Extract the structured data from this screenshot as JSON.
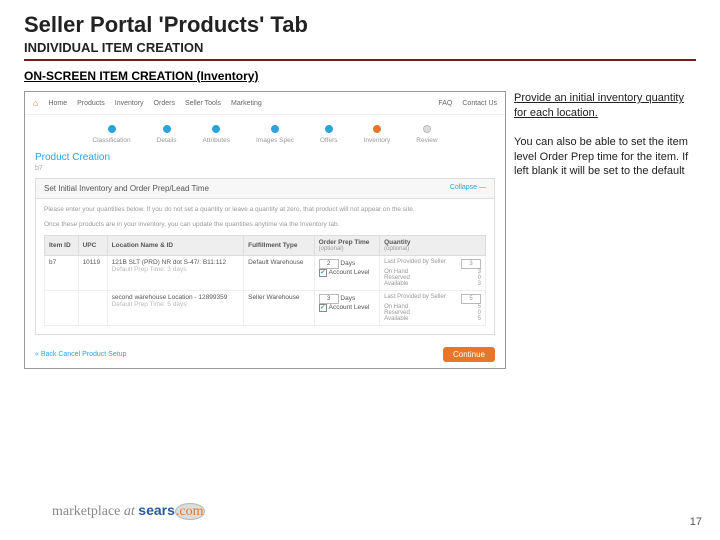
{
  "title": "Seller Portal 'Products' Tab",
  "subtitle": "INDIVIDUAL ITEM CREATION",
  "section_head": "ON-SCREEN ITEM CREATION (Inventory)",
  "notes": {
    "p1": "Provide an initial inventory quantity for each location.",
    "p2": "You can also be able to set the item level Order Prep time for the item. If left blank it will be set to the default"
  },
  "topnav": {
    "home": "Home",
    "items": [
      "Products",
      "Inventory",
      "Orders",
      "Seller Tools",
      "Marketing"
    ],
    "right": [
      "FAQ",
      "Contact Us"
    ]
  },
  "steps": [
    {
      "label": "Classification",
      "state": "prev"
    },
    {
      "label": "Details",
      "state": "prev"
    },
    {
      "label": "Attributes",
      "state": "prev"
    },
    {
      "label": "Images Spec",
      "state": "prev"
    },
    {
      "label": "Offers",
      "state": "prev"
    },
    {
      "label": "Inventory",
      "state": "active"
    },
    {
      "label": "Review",
      "state": ""
    }
  ],
  "page_header": "Product Creation",
  "page_sku": "b7",
  "panel_title": "Set Initial Inventory and Order Prep/Lead Time",
  "collapse_label": "Collapse —",
  "hint1": "Please enter your quantities below. If you do not set a quantity or leave a quantity at zero, that product will not appear on the site.",
  "hint2": "Once these products are in your inventory, you can update the quantities anytime via the Inventory tab.",
  "cols": {
    "item": "Item ID",
    "upc": "UPC",
    "loc": "Location Name & ID",
    "ftype": "Fulfillment Type",
    "prep": "Order Prep Time",
    "prep_sub": "(optional)",
    "qty": "Quantity",
    "qty_sub": "(optional)"
  },
  "rows": [
    {
      "item": "b7",
      "upc": "10119",
      "loc_name": "121B SLT (PRD) NR dot S-47/: B11:112",
      "loc_sub": "Default Prep Time: 3 days",
      "loc_id": "Default Warehouse",
      "prep": "2",
      "prep_unit": "Days",
      "acct": "Account Level",
      "qty": "3",
      "stats": {
        "last": "Last Provided by Seller",
        "onhand": "On Hand",
        "reserved": "Reserved",
        "available": "Available"
      },
      "vals": {
        "last": "3",
        "onhand": "3",
        "reserved": "0",
        "available": "3"
      }
    },
    {
      "item": "",
      "upc": "",
      "loc_name": "second warehouse Location - 12899359",
      "loc_sub": "Default Prep Time: 5 days",
      "loc_id": "Seller Warehouse",
      "prep": "3",
      "prep_unit": "Days",
      "acct": "Account Level",
      "qty": "5",
      "stats": {
        "last": "Last Provided by Seller",
        "onhand": "On Hand",
        "reserved": "Reserved",
        "available": "Available"
      },
      "vals": {
        "last": "5",
        "onhand": "5",
        "reserved": "0",
        "available": "5"
      }
    }
  ],
  "back_label": "« Back    Cancel Product Setup",
  "continue_label": "Continue",
  "footer": {
    "a": "marketplace",
    "b": "at",
    "brand": "sears",
    "dot": ".com"
  },
  "pagenum": "17"
}
